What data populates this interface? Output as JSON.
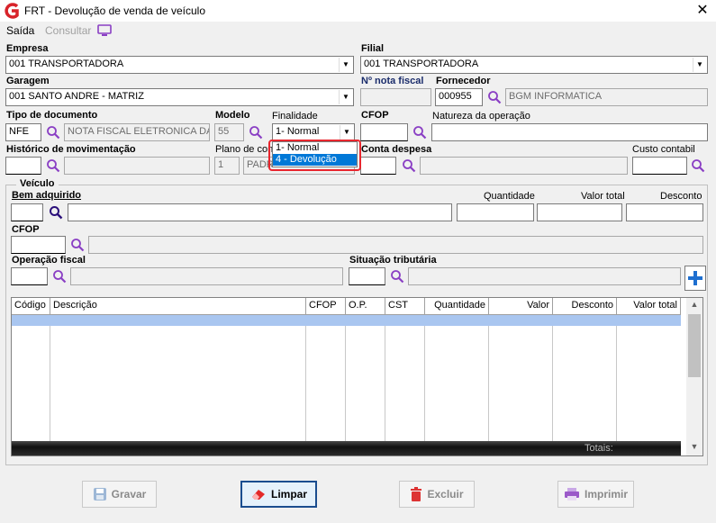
{
  "window": {
    "title": "FRT - Devolução de venda de veículo"
  },
  "menu": {
    "saida": "Saída",
    "consultar": "Consultar"
  },
  "empresa": {
    "label": "Empresa",
    "value": "001 TRANSPORTADORA"
  },
  "filial": {
    "label": "Filial",
    "value": "001 TRANSPORTADORA"
  },
  "garagem": {
    "label": "Garagem",
    "value": "001 SANTO ANDRE - MATRIZ"
  },
  "nota_fiscal": {
    "label": "Nº nota fiscal",
    "value": ""
  },
  "fornecedor": {
    "label": "Fornecedor",
    "code": "000955",
    "name": "BGM INFORMATICA"
  },
  "tipo_documento": {
    "label": "Tipo de documento",
    "code": "NFE",
    "name": "NOTA FISCAL ELETRONICA DA"
  },
  "modelo": {
    "label": "Modelo",
    "value": "55"
  },
  "finalidade": {
    "label": "Finalidade",
    "value": "1- Normal",
    "options": [
      "1- Normal",
      "4 - Devolução"
    ],
    "highlight_color": "#0078d7",
    "annotation_color": "#e8262e"
  },
  "cfop_header": {
    "label": "CFOP",
    "value": ""
  },
  "natureza": {
    "label": "Natureza da operação",
    "value": ""
  },
  "historico": {
    "label": "Histórico de movimentação",
    "code": "",
    "name": ""
  },
  "plano_contas": {
    "label": "Plano de con",
    "code": "1",
    "name": "PADRÃO"
  },
  "conta_despesa": {
    "label": "Conta despesa",
    "code": "",
    "name": ""
  },
  "custo_contabil": {
    "label": "Custo contabil",
    "value": ""
  },
  "veiculo": {
    "group_label": "Veículo",
    "bem_label": "Bem adquirido",
    "quantidade_label": "Quantidade",
    "valor_total_label": "Valor total",
    "desconto_label": "Desconto",
    "cfop_label": "CFOP",
    "operacao_label": "Operação fiscal",
    "situacao_label": "Situação tributária"
  },
  "grid": {
    "columns": [
      "Código",
      "Descrição",
      "CFOP",
      "O.P.",
      "CST",
      "Quantidade",
      "Valor",
      "Desconto",
      "Valor total"
    ],
    "footer_label": "Totais:",
    "selection_color": "#a9c6f0"
  },
  "buttons": {
    "gravar": "Gravar",
    "limpar": "Limpar",
    "excluir": "Excluir",
    "imprimir": "Imprimir"
  },
  "icons": {
    "app": "app-logo-icon",
    "magnifier_color": "#8a3fc4",
    "add_color": "#1e6fd0"
  }
}
